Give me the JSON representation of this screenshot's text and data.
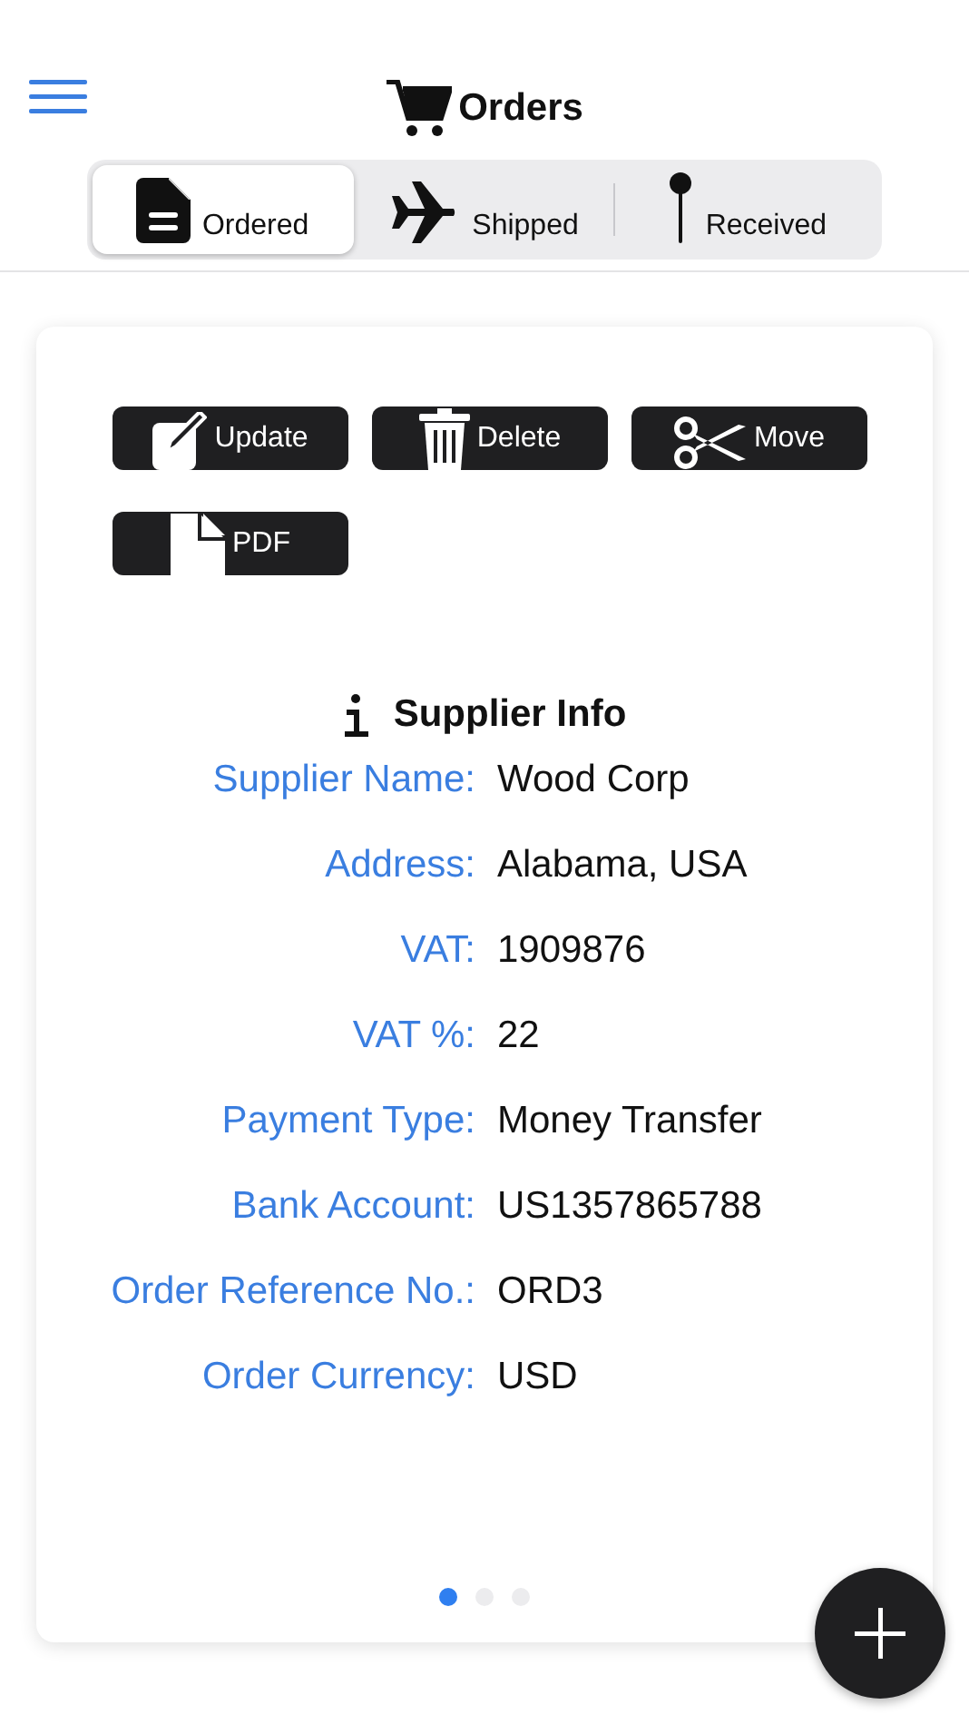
{
  "header": {
    "title": "Orders"
  },
  "tabs": [
    {
      "label": "Ordered",
      "kind": "document",
      "selected": true
    },
    {
      "label": "Shipped",
      "kind": "plane",
      "selected": false
    },
    {
      "label": "Received",
      "kind": "pin",
      "selected": false
    }
  ],
  "actions": [
    {
      "label": "Update",
      "kind": "edit"
    },
    {
      "label": "Delete",
      "kind": "trash"
    },
    {
      "label": "Move",
      "kind": "scissors"
    },
    {
      "label": "PDF",
      "kind": "file"
    }
  ],
  "section": {
    "title": "Supplier Info"
  },
  "fields": [
    {
      "label": "Supplier Name:",
      "value": "Wood Corp"
    },
    {
      "label": "Address:",
      "value": "Alabama, USA"
    },
    {
      "label": "VAT:",
      "value": "1909876"
    },
    {
      "label": "VAT %:",
      "value": "22"
    },
    {
      "label": "Payment Type:",
      "value": "Money Transfer"
    },
    {
      "label": "Bank Account:",
      "value": "US1357865788"
    },
    {
      "label": "Order Reference No.:",
      "value": "ORD3"
    },
    {
      "label": "Order Currency:",
      "value": "USD"
    }
  ],
  "pages": [
    {
      "selected": true
    },
    {
      "selected": false
    },
    {
      "selected": false
    }
  ]
}
